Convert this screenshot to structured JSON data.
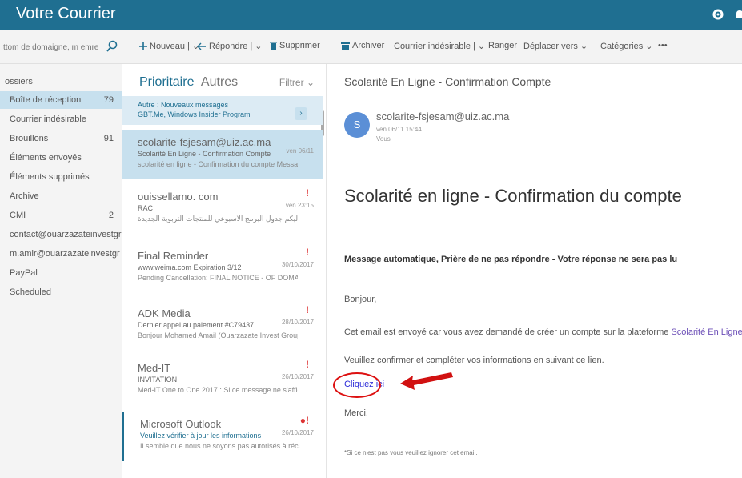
{
  "app": {
    "title": "Votre Courrier"
  },
  "toolbar": {
    "search_placeholder": "ttom de domaigne, m emre",
    "new": "Nouveau",
    "reply": "Répondre",
    "delete": "Supprimer",
    "archive": "Archiver",
    "junk": "Courrier indésirable",
    "sweep": "Ranger",
    "move": "Déplacer vers",
    "categories": "Catégories",
    "more": "•••"
  },
  "folders": {
    "header": "ossiers",
    "items": [
      {
        "label": "Boîte de réception",
        "count": "79"
      },
      {
        "label": "Courrier indésirable",
        "count": ""
      },
      {
        "label": "Brouillons",
        "count": "91"
      },
      {
        "label": "Éléments envoyés",
        "count": ""
      },
      {
        "label": "Éléments supprimés",
        "count": ""
      },
      {
        "label": "Archive",
        "count": ""
      },
      {
        "label": "CMI",
        "count": "2"
      },
      {
        "label": "contact@ouarzazateinvestgr",
        "count": ""
      },
      {
        "label": "m.amir@ouarzazateinvestgr",
        "count": ""
      },
      {
        "label": "PayPal",
        "count": ""
      },
      {
        "label": "Scheduled",
        "count": ""
      }
    ]
  },
  "list": {
    "tab_focused": "Prioritaire",
    "tab_other": "Autres",
    "filter": "Filtrer",
    "messages": [
      {
        "from": "Autre : Nouveaux messages",
        "subject": "GBT.Me, Windows Insider Program",
        "preview": "",
        "date": ""
      },
      {
        "from": "scolarite-fsjesam@uiz.ac.ma",
        "subject": "Scolarité En Ligne - Confirmation Compte",
        "preview": "scolarité en ligne - Confirmation du compte Messa...",
        "date": "ven 06/11"
      },
      {
        "from": "ouissellamo. com",
        "subject": "RAC",
        "preview": "إليكم جدول البرمج الأسبوعي للمنتجات التربوية الجديدة ...",
        "date": "ven 23:15"
      },
      {
        "from": "Final Reminder",
        "subject": "www.weima.com Expiration 3/12",
        "preview": "Pending Cancellation: FINAL NOTICE - OF DOMAIN w...",
        "date": "30/10/2017"
      },
      {
        "from": "ADK Media",
        "subject": "Dernier appel au paiement #C79437",
        "preview": "Bonjour Mohamed Amail (Ouarzazate Invest Group) ...",
        "date": "28/10/2017"
      },
      {
        "from": "Med-IT",
        "subject": "INVITATION",
        "preview": "Med-IT One to One 2017 : Si ce message ne s'affiche ...",
        "date": "26/10/2017"
      },
      {
        "from": "Microsoft Outlook",
        "subject": "Veuillez vérifier à jour les informations",
        "preview": "Il semble que nous ne soyons pas autorisés à récupére...",
        "date": "26/10/2017"
      }
    ]
  },
  "reading": {
    "subject": "Scolarité En Ligne - Confirmation Compte",
    "avatar_letter": "S",
    "sender": "scolarite-fsjesam@uiz.ac.ma",
    "date": "ven 06/11 15:44",
    "to": "Vous",
    "heading": "Scolarité en ligne - Confirmation du compte",
    "auto_message": "Message automatique, Prière de ne pas répondre - Votre réponse ne sera pas lu",
    "greeting": "Bonjour,",
    "line1": "Cet email est envoyé car vous avez demandé de créer un compte sur la plateforme",
    "platform_link": "Scolarité En Ligne",
    "line2": "Veuillez confirmer et compléter vos informations en suivant ce lien.",
    "click_here": "Cliquez ici",
    "thanks": "Merci.",
    "footer": "*Si ce n'est pas vous veuillez ignorer cet email."
  },
  "colors": {
    "accent": "#1f6f91",
    "selected_bg": "#c7e0ee",
    "annotation": "#d11111"
  }
}
